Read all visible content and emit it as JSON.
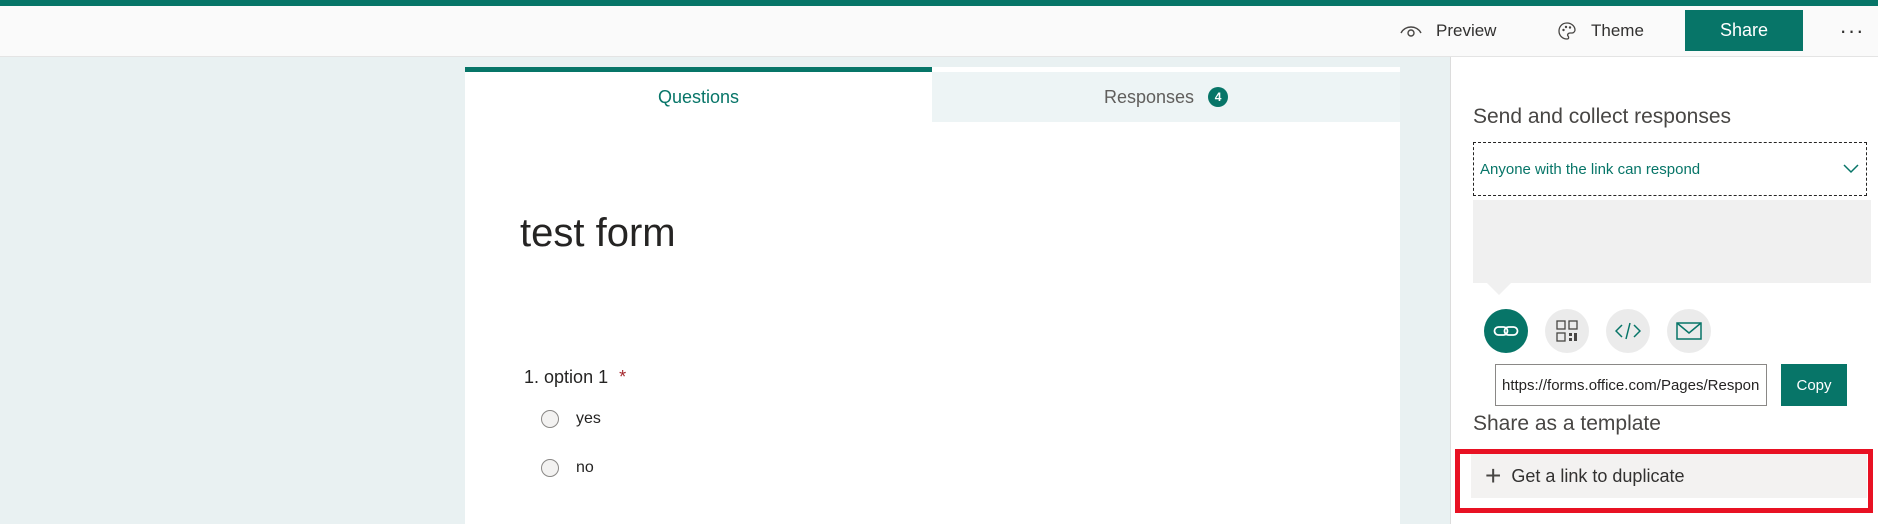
{
  "toolbar": {
    "preview_label": "Preview",
    "theme_label": "Theme",
    "share_label": "Share",
    "more_label": "···"
  },
  "tabs": {
    "questions_label": "Questions",
    "responses_label": "Responses",
    "responses_count": "4"
  },
  "form": {
    "title": "test form",
    "question": {
      "number": "1.",
      "text": "option 1",
      "required_mark": "*",
      "options": [
        "yes",
        "no"
      ]
    }
  },
  "panel": {
    "send_heading": "Send and collect responses",
    "audience_selected": "Anyone with the link can respond",
    "link_value": "https://forms.office.com/Pages/ResponsePage.aspx",
    "copy_label": "Copy",
    "share_icons": [
      "link-icon",
      "qr-code-icon",
      "embed-code-icon",
      "mail-icon"
    ],
    "template_heading": "Share as a template",
    "duplicate_label": "Get a link to duplicate"
  },
  "colors": {
    "accent": "#077568",
    "highlight": "#e81123",
    "background": "#e9f1f2"
  }
}
